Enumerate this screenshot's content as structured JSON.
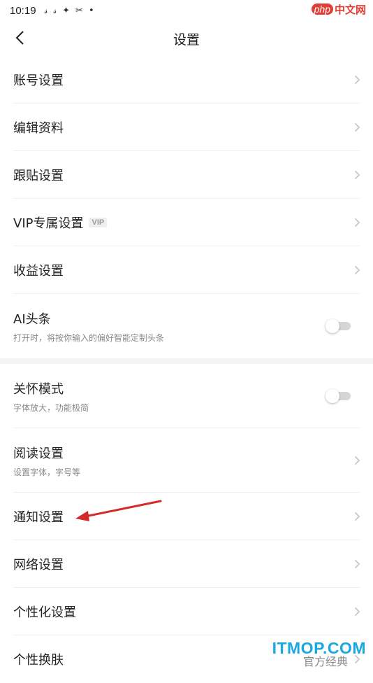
{
  "status_bar": {
    "time": "10:19",
    "icons": [
      "app-notification-icon",
      "app-notification-icon",
      "capcut-icon",
      "capcut-logo-icon",
      "dot-icon"
    ]
  },
  "watermark_top": {
    "php": "php",
    "cn": "中文网"
  },
  "header": {
    "title": "设置"
  },
  "settings": [
    {
      "label": "账号设置",
      "kind": "link"
    },
    {
      "label": "编辑资料",
      "kind": "link"
    },
    {
      "label": "跟贴设置",
      "kind": "link"
    },
    {
      "label": "VIP专属设置",
      "badge": "VIP",
      "kind": "link"
    },
    {
      "label": "收益设置",
      "kind": "link"
    },
    {
      "label": "AI头条",
      "sub": "打开时，将按你输入的偏好智能定制头条",
      "kind": "toggle",
      "on": false
    },
    {
      "label": "关怀模式",
      "sub": "字体放大，功能极简",
      "kind": "toggle",
      "on": false
    },
    {
      "label": "阅读设置",
      "sub": "设置字体，字号等",
      "kind": "link"
    },
    {
      "label": "通知设置",
      "kind": "link"
    },
    {
      "label": "网络设置",
      "kind": "link"
    },
    {
      "label": "个性化设置",
      "kind": "link"
    },
    {
      "label": "个性换肤",
      "value": "官方经典",
      "kind": "link"
    }
  ],
  "colors": {
    "annotation_arrow": "#d42a2a",
    "watermark_bottom": "#1aa8e0",
    "toggle_off": "#d6d6d6"
  },
  "watermark_bottom": "ITMOP.COM"
}
